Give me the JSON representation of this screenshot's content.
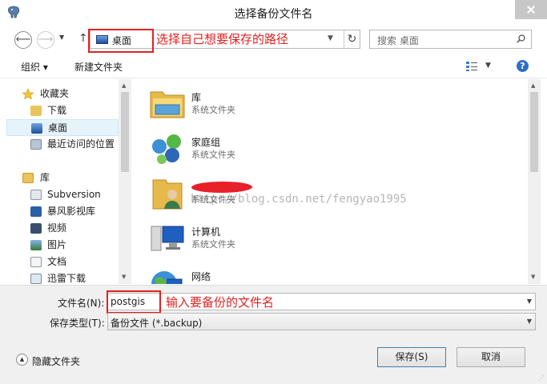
{
  "window": {
    "title": "选择备份文件名"
  },
  "nav": {
    "back": "⟵",
    "forward": "⟶",
    "up": "↑"
  },
  "address": {
    "current": "桌面"
  },
  "search": {
    "placeholder": "搜索 桌面"
  },
  "annotations": {
    "path_hint": "选择自己想要保存的路径",
    "name_hint": "输入要备份的文件名"
  },
  "toolbar": {
    "organize": "组织 ▾",
    "new_folder": "新建文件夹"
  },
  "sidebar": {
    "items": [
      {
        "label": "收藏夹",
        "icon": "star-icon",
        "group": true
      },
      {
        "label": "下载",
        "icon": "download-folder-icon"
      },
      {
        "label": "桌面",
        "icon": "desktop-icon",
        "selected": true
      },
      {
        "label": "最近访问的位置",
        "icon": "recent-places-icon"
      },
      {
        "label": "库",
        "icon": "library-icon",
        "group": true
      },
      {
        "label": "Subversion",
        "icon": "subversion-library-icon"
      },
      {
        "label": "暴风影视库",
        "icon": "video-library-icon"
      },
      {
        "label": "视频",
        "icon": "videos-icon"
      },
      {
        "label": "图片",
        "icon": "pictures-icon"
      },
      {
        "label": "文档",
        "icon": "documents-icon"
      },
      {
        "label": "迅雷下载",
        "icon": "xunlei-download-icon"
      }
    ]
  },
  "files": [
    {
      "name": "库",
      "type": "系统文件夹",
      "icon": "library-folder-icon"
    },
    {
      "name": "家庭组",
      "type": "系统文件夹",
      "icon": "homegroup-icon"
    },
    {
      "name": "",
      "type": "系统文件夹",
      "icon": "user-folder-icon"
    },
    {
      "name": "计算机",
      "type": "系统文件夹",
      "icon": "computer-icon"
    },
    {
      "name": "网络",
      "type": "",
      "icon": "network-icon"
    }
  ],
  "watermark": "http://blog.csdn.net/fengyao1995",
  "form": {
    "filename_label": "文件名(N):",
    "filename_value": "postgis",
    "filetype_label": "保存类型(T):",
    "filetype_value": "备份文件 (*.backup)"
  },
  "footer": {
    "hide_folders": "隐藏文件夹",
    "save": "保存(S)",
    "cancel": "取消"
  }
}
